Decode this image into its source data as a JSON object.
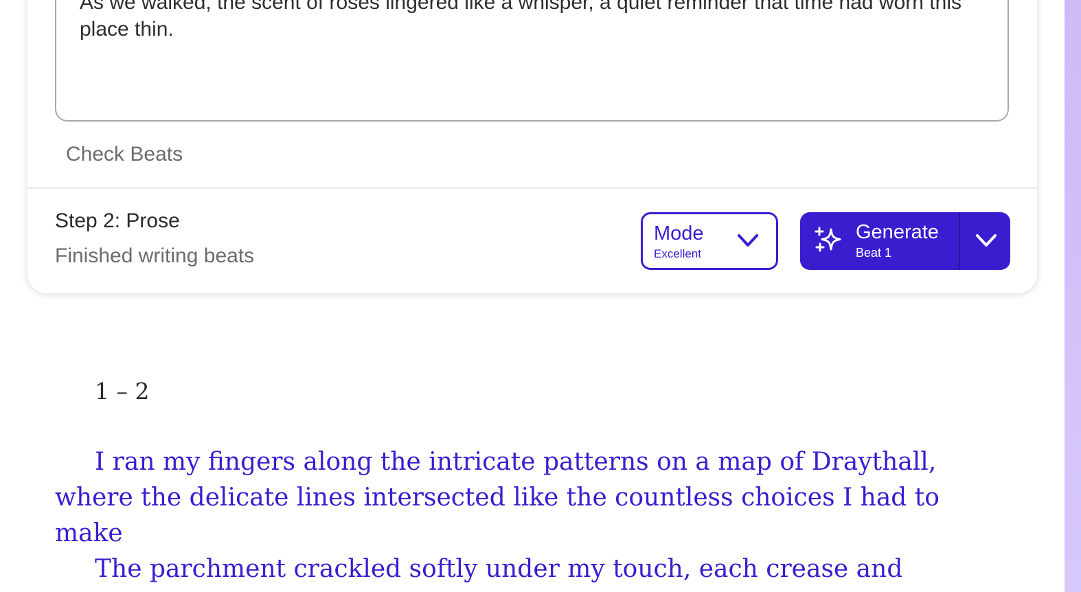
{
  "beats": {
    "text": "As we walked, the scent of roses lingered like a whisper, a quiet reminder that time had worn this place thin.",
    "check_label": "Check Beats"
  },
  "step2": {
    "title": "Step 2: Prose",
    "subtitle": "Finished writing beats",
    "mode": {
      "label": "Mode",
      "value": "Excellent",
      "icon": "chevron-down-icon"
    },
    "generate": {
      "label": "Generate",
      "sub": "Beat 1",
      "icon": "sparkle-icon",
      "dropdown_icon": "chevron-down-icon"
    }
  },
  "prose": {
    "range": "1 – 2",
    "paragraphs": [
      "I ran my fingers along the intricate patterns on a map of Draythall, where the delicate lines intersected like the countless choices I had to make",
      "The parchment crackled softly under my touch, each crease and"
    ]
  },
  "colors": {
    "accent": "#3b1dd0",
    "sidebar": "#cdbbf5"
  }
}
